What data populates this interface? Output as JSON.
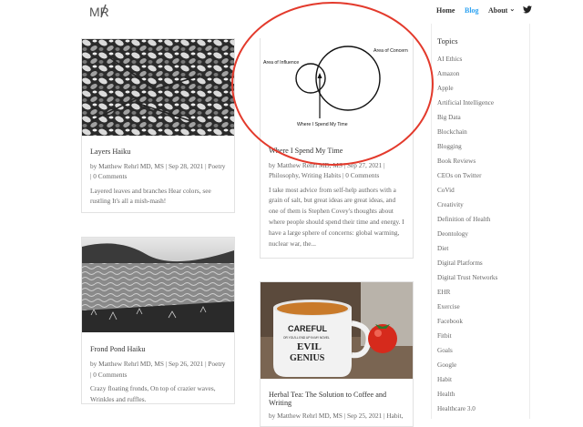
{
  "header": {
    "logo_text": "MR",
    "nav": [
      {
        "label": "Home"
      },
      {
        "label": "Blog"
      },
      {
        "label": "About"
      }
    ],
    "about_chevron": "⌄"
  },
  "posts": [
    {
      "title": "Layers Haiku",
      "meta_line1": "by Matthew Rehrl MD, MS | Sep 28, 2021 | Poetry",
      "meta_line2": "| 0 Comments",
      "excerpt_line1": "Layered leaves and branches Hear colors, see",
      "excerpt_line2": "rustling It's all a mish-mash!"
    },
    {
      "title": "Where I Spend My Time",
      "meta_line1": "by Matthew Rehrl MD, MS | Sep 27, 2021 |",
      "meta_line2": "Philosophy, Writing Habits | 0 Comments",
      "excerpt_line1": "I take most advice from self-help authors with a",
      "excerpt_line2": "grain of salt, but great ideas are great ideas, and",
      "excerpt_line3": "one of them is Stephen Covey's thoughts about",
      "excerpt_line4": "where people should spend their time and energy. I",
      "excerpt_line5": "have a large sphere of concerns: global warming,",
      "excerpt_line6": "nuclear war, the...",
      "diagram": {
        "label_influence": "Area of Influence",
        "label_concern": "Area of Concern",
        "label_time": "Where I Spend My Time"
      }
    },
    {
      "title": "Frond Pond Haiku",
      "meta_line1": "by Matthew Rehrl MD, MS | Sep 26, 2021 | Poetry",
      "meta_line2": "| 0 Comments",
      "excerpt_line1": "Crazy floating fronds, On top of crazier waves,",
      "excerpt_line2": "Wrinkles and ruffles."
    },
    {
      "title_line1": "Herbal Tea: The Solution to Coffee and",
      "title_line2": "Writing",
      "meta_line1": "by Matthew Rehrl MD, MS | Sep 25, 2021 | Habit,",
      "mug_text1": "CAREFUL",
      "mug_text2": "OR YOU'LL END UP IN MY NOVEL",
      "mug_text3": "EVIL",
      "mug_text4": "GENIUS"
    }
  ],
  "sidebar": {
    "title": "Topics",
    "items": [
      "AI Ethics",
      "Amazon",
      "Apple",
      "Artificial Intelligence",
      "Big Data",
      "Blockchain",
      "Blogging",
      "Book Reviews",
      "CEOs on Twitter",
      "CoVid",
      "Creativity",
      "Definition of Health",
      "Deontology",
      "Diet",
      "Digital Platforms",
      "Digital Trust Networks",
      "EHR",
      "Exercise",
      "Facebook",
      "Fitbit",
      "Goals",
      "Google",
      "Habit",
      "Health",
      "Healthcare 3.0"
    ]
  },
  "colors": {
    "accent": "#2ea3f2",
    "annotation": "#e33a2c"
  }
}
